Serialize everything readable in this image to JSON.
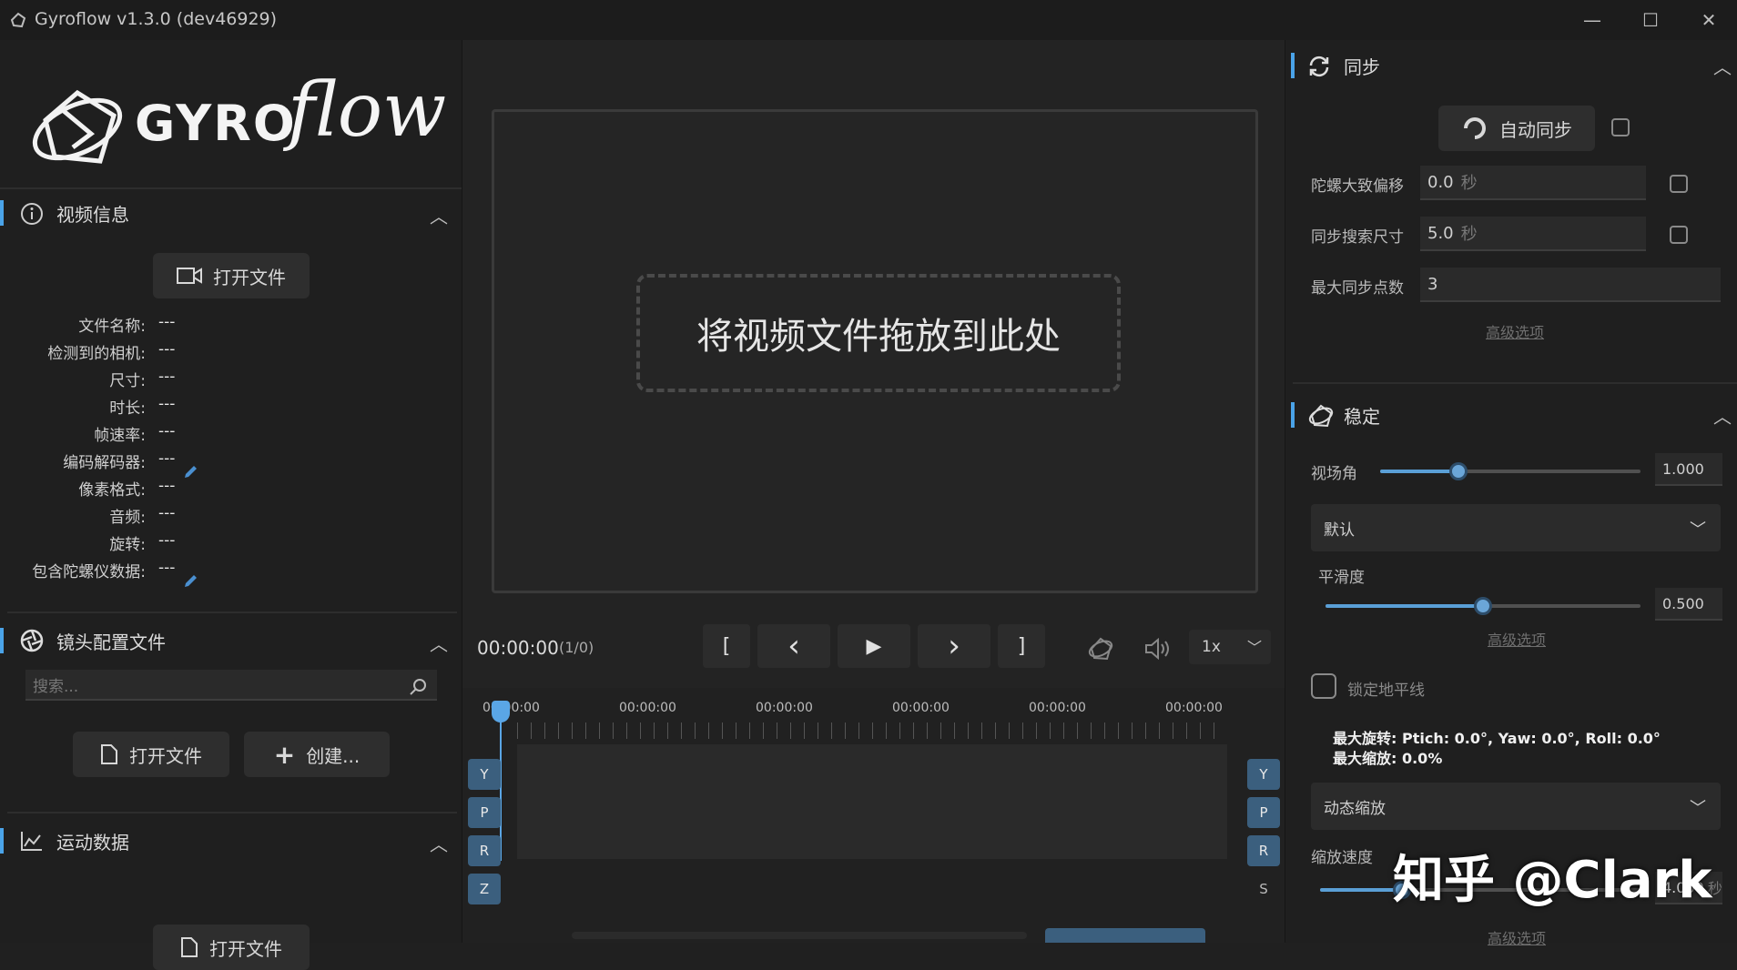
{
  "window": {
    "title": "Gyroflow v1.3.0 (dev46929)",
    "minimize": "—",
    "maximize": "☐",
    "close": "✕"
  },
  "brand": {
    "logo_text": "GYRO",
    "logo_script": "flow"
  },
  "video_info": {
    "title": "视频信息",
    "open_file": "打开文件",
    "fields": [
      {
        "label": "文件名称:",
        "value": "---"
      },
      {
        "label": "检测到的相机:",
        "value": "---"
      },
      {
        "label": "尺寸:",
        "value": "---"
      },
      {
        "label": "时长:",
        "value": "---"
      },
      {
        "label": "帧速率:",
        "value": "---"
      },
      {
        "label": "编码解码器:",
        "value": "---"
      },
      {
        "label": "像素格式:",
        "value": "---"
      },
      {
        "label": "音频:",
        "value": "---"
      },
      {
        "label": "旋转:",
        "value": "---"
      },
      {
        "label": "包含陀螺仪数据:",
        "value": "---"
      }
    ]
  },
  "lens_profile": {
    "title": "镜头配置文件",
    "search_placeholder": "搜索...",
    "open_file": "打开文件",
    "create": "创建..."
  },
  "motion_data": {
    "title": "运动数据",
    "open_file": "打开文件"
  },
  "preview": {
    "drop_hint": "将视频文件拖放到此处"
  },
  "playback": {
    "time": "00:00:00",
    "frames": "(1/0)",
    "btn_in": "[",
    "btn_prev": "‹",
    "btn_play": "▶",
    "btn_next": "›",
    "btn_out": "]",
    "speed": "1x"
  },
  "timeline": {
    "ticks": [
      "00:00:00",
      "00:00:00",
      "00:00:00",
      "00:00:00",
      "00:00:00",
      "00:00:00"
    ],
    "left_axes": [
      "Y",
      "P",
      "R",
      "Z"
    ],
    "right_axes": [
      "Y",
      "P",
      "R",
      "S"
    ]
  },
  "sync": {
    "title": "同步",
    "auto_sync": "自动同步",
    "rough_offset_label": "陀螺大致偏移",
    "rough_offset_value": "0.0",
    "rough_offset_unit": "秒",
    "search_size_label": "同步搜索尺寸",
    "search_size_value": "5.0",
    "search_size_unit": "秒",
    "max_points_label": "最大同步点数",
    "max_points_value": "3",
    "advanced": "高级选项"
  },
  "stabilization": {
    "title": "稳定",
    "fov_label": "视场角",
    "fov_value": "1.000",
    "fov_level": 0.3,
    "method": "默认",
    "smoothness_label": "平滑度",
    "smoothness_value": "0.500",
    "smoothness_level": 0.5,
    "advanced": "高级选项",
    "lock_horizon": "锁定地平线",
    "max_rotation": "最大旋转: Ptich: 0.0°, Yaw: 0.0°, Roll: 0.0°",
    "max_zoom": "最大缩放: 0.0%",
    "dynamic_zoom": "动态缩放",
    "zoom_speed_label": "缩放速度",
    "zoom_speed_value": "4.000",
    "zoom_speed_unit": "秒",
    "advanced2": "高级选项"
  },
  "watermark": {
    "text": "知乎 @Clark"
  },
  "colors": {
    "accent": "#4aa3e8",
    "axis_button": "#3b5f7e"
  }
}
